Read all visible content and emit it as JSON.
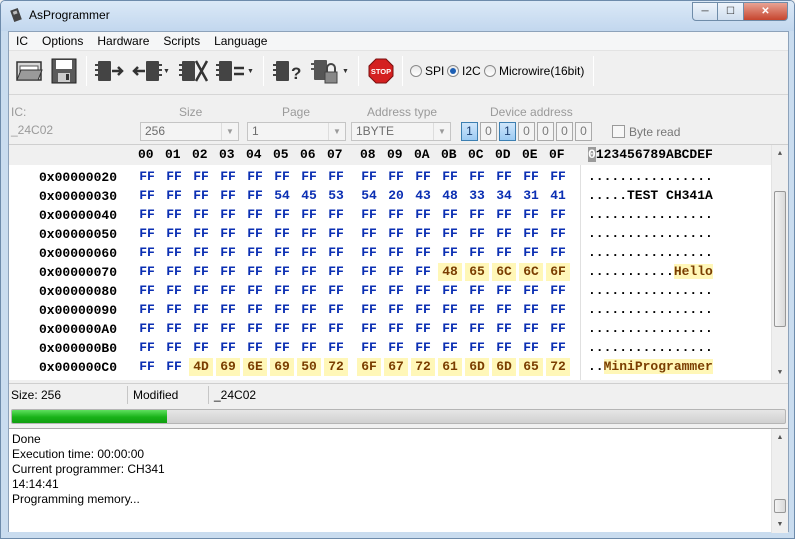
{
  "window": {
    "title": "AsProgrammer"
  },
  "menu": [
    "IC",
    "Options",
    "Hardware",
    "Scripts",
    "Language"
  ],
  "toolbar": {
    "icons": [
      "open-icon",
      "save-icon",
      "read-icon",
      "write-icon",
      "erase-icon",
      "verify-icon",
      "check-blank-icon",
      "lock-icon",
      "stop-icon"
    ],
    "stop_label": "STOP",
    "interfaces": [
      {
        "label": "SPI",
        "selected": false
      },
      {
        "label": "I2C",
        "selected": true
      },
      {
        "label": "Microwire(16bit)",
        "selected": false
      }
    ]
  },
  "settings": {
    "ic_label": "IC:",
    "ic_value": "_24C02",
    "size_label": "Size",
    "size_value": "256",
    "page_label": "Page",
    "page_value": "1",
    "address_type_label": "Address type",
    "address_type_value": "1BYTE",
    "device_address_label": "Device address",
    "device_address_bits": [
      "1",
      "0",
      "1",
      "0",
      "0",
      "0",
      "0"
    ],
    "byte_read_label": "Byte read"
  },
  "hex": {
    "columns": [
      "00",
      "01",
      "02",
      "03",
      "04",
      "05",
      "06",
      "07",
      "08",
      "09",
      "0A",
      "0B",
      "0C",
      "0D",
      "0E",
      "0F"
    ],
    "ascii_header": "0123456789ABCDEF",
    "rows": [
      {
        "addr": "0x00000020",
        "bytes": [
          "FF",
          "FF",
          "FF",
          "FF",
          "FF",
          "FF",
          "FF",
          "FF",
          "FF",
          "FF",
          "FF",
          "FF",
          "FF",
          "FF",
          "FF",
          "FF"
        ],
        "ascii": "................",
        "modified_from": -1,
        "modified_to": -1
      },
      {
        "addr": "0x00000030",
        "bytes": [
          "FF",
          "FF",
          "FF",
          "FF",
          "FF",
          "54",
          "45",
          "53",
          "54",
          "20",
          "43",
          "48",
          "33",
          "34",
          "31",
          "41"
        ],
        "ascii": ".....TEST CH341A",
        "modified_from": -1,
        "modified_to": -1
      },
      {
        "addr": "0x00000040",
        "bytes": [
          "FF",
          "FF",
          "FF",
          "FF",
          "FF",
          "FF",
          "FF",
          "FF",
          "FF",
          "FF",
          "FF",
          "FF",
          "FF",
          "FF",
          "FF",
          "FF"
        ],
        "ascii": "................",
        "modified_from": -1,
        "modified_to": -1
      },
      {
        "addr": "0x00000050",
        "bytes": [
          "FF",
          "FF",
          "FF",
          "FF",
          "FF",
          "FF",
          "FF",
          "FF",
          "FF",
          "FF",
          "FF",
          "FF",
          "FF",
          "FF",
          "FF",
          "FF"
        ],
        "ascii": "................",
        "modified_from": -1,
        "modified_to": -1
      },
      {
        "addr": "0x00000060",
        "bytes": [
          "FF",
          "FF",
          "FF",
          "FF",
          "FF",
          "FF",
          "FF",
          "FF",
          "FF",
          "FF",
          "FF",
          "FF",
          "FF",
          "FF",
          "FF",
          "FF"
        ],
        "ascii": "................",
        "modified_from": -1,
        "modified_to": -1
      },
      {
        "addr": "0x00000070",
        "bytes": [
          "FF",
          "FF",
          "FF",
          "FF",
          "FF",
          "FF",
          "FF",
          "FF",
          "FF",
          "FF",
          "FF",
          "48",
          "65",
          "6C",
          "6C",
          "6F"
        ],
        "ascii": "...........Hello",
        "modified_from": 11,
        "modified_to": 15
      },
      {
        "addr": "0x00000080",
        "bytes": [
          "FF",
          "FF",
          "FF",
          "FF",
          "FF",
          "FF",
          "FF",
          "FF",
          "FF",
          "FF",
          "FF",
          "FF",
          "FF",
          "FF",
          "FF",
          "FF"
        ],
        "ascii": "................",
        "modified_from": -1,
        "modified_to": -1
      },
      {
        "addr": "0x00000090",
        "bytes": [
          "FF",
          "FF",
          "FF",
          "FF",
          "FF",
          "FF",
          "FF",
          "FF",
          "FF",
          "FF",
          "FF",
          "FF",
          "FF",
          "FF",
          "FF",
          "FF"
        ],
        "ascii": "................",
        "modified_from": -1,
        "modified_to": -1
      },
      {
        "addr": "0x000000A0",
        "bytes": [
          "FF",
          "FF",
          "FF",
          "FF",
          "FF",
          "FF",
          "FF",
          "FF",
          "FF",
          "FF",
          "FF",
          "FF",
          "FF",
          "FF",
          "FF",
          "FF"
        ],
        "ascii": "................",
        "modified_from": -1,
        "modified_to": -1
      },
      {
        "addr": "0x000000B0",
        "bytes": [
          "FF",
          "FF",
          "FF",
          "FF",
          "FF",
          "FF",
          "FF",
          "FF",
          "FF",
          "FF",
          "FF",
          "FF",
          "FF",
          "FF",
          "FF",
          "FF"
        ],
        "ascii": "................",
        "modified_from": -1,
        "modified_to": -1
      },
      {
        "addr": "0x000000C0",
        "bytes": [
          "FF",
          "FF",
          "4D",
          "69",
          "6E",
          "69",
          "50",
          "72",
          "6F",
          "67",
          "72",
          "61",
          "6D",
          "6D",
          "65",
          "72"
        ],
        "ascii": "..MiniProgrammer",
        "modified_from": 2,
        "modified_to": 15
      }
    ]
  },
  "status": {
    "size_text": "Size: 256",
    "modified_text": "Modified",
    "chip_text": "_24C02"
  },
  "progress": {
    "fraction": 0.2
  },
  "log": {
    "lines": [
      "Done",
      "Execution time: 00:00:00",
      "Current programmer: CH341",
      "14:14:41",
      "Programming memory..."
    ]
  },
  "colors": {
    "hex_value": "#0b2fb3",
    "modified_bg": "#fff7b8",
    "progress": "#19b219"
  }
}
